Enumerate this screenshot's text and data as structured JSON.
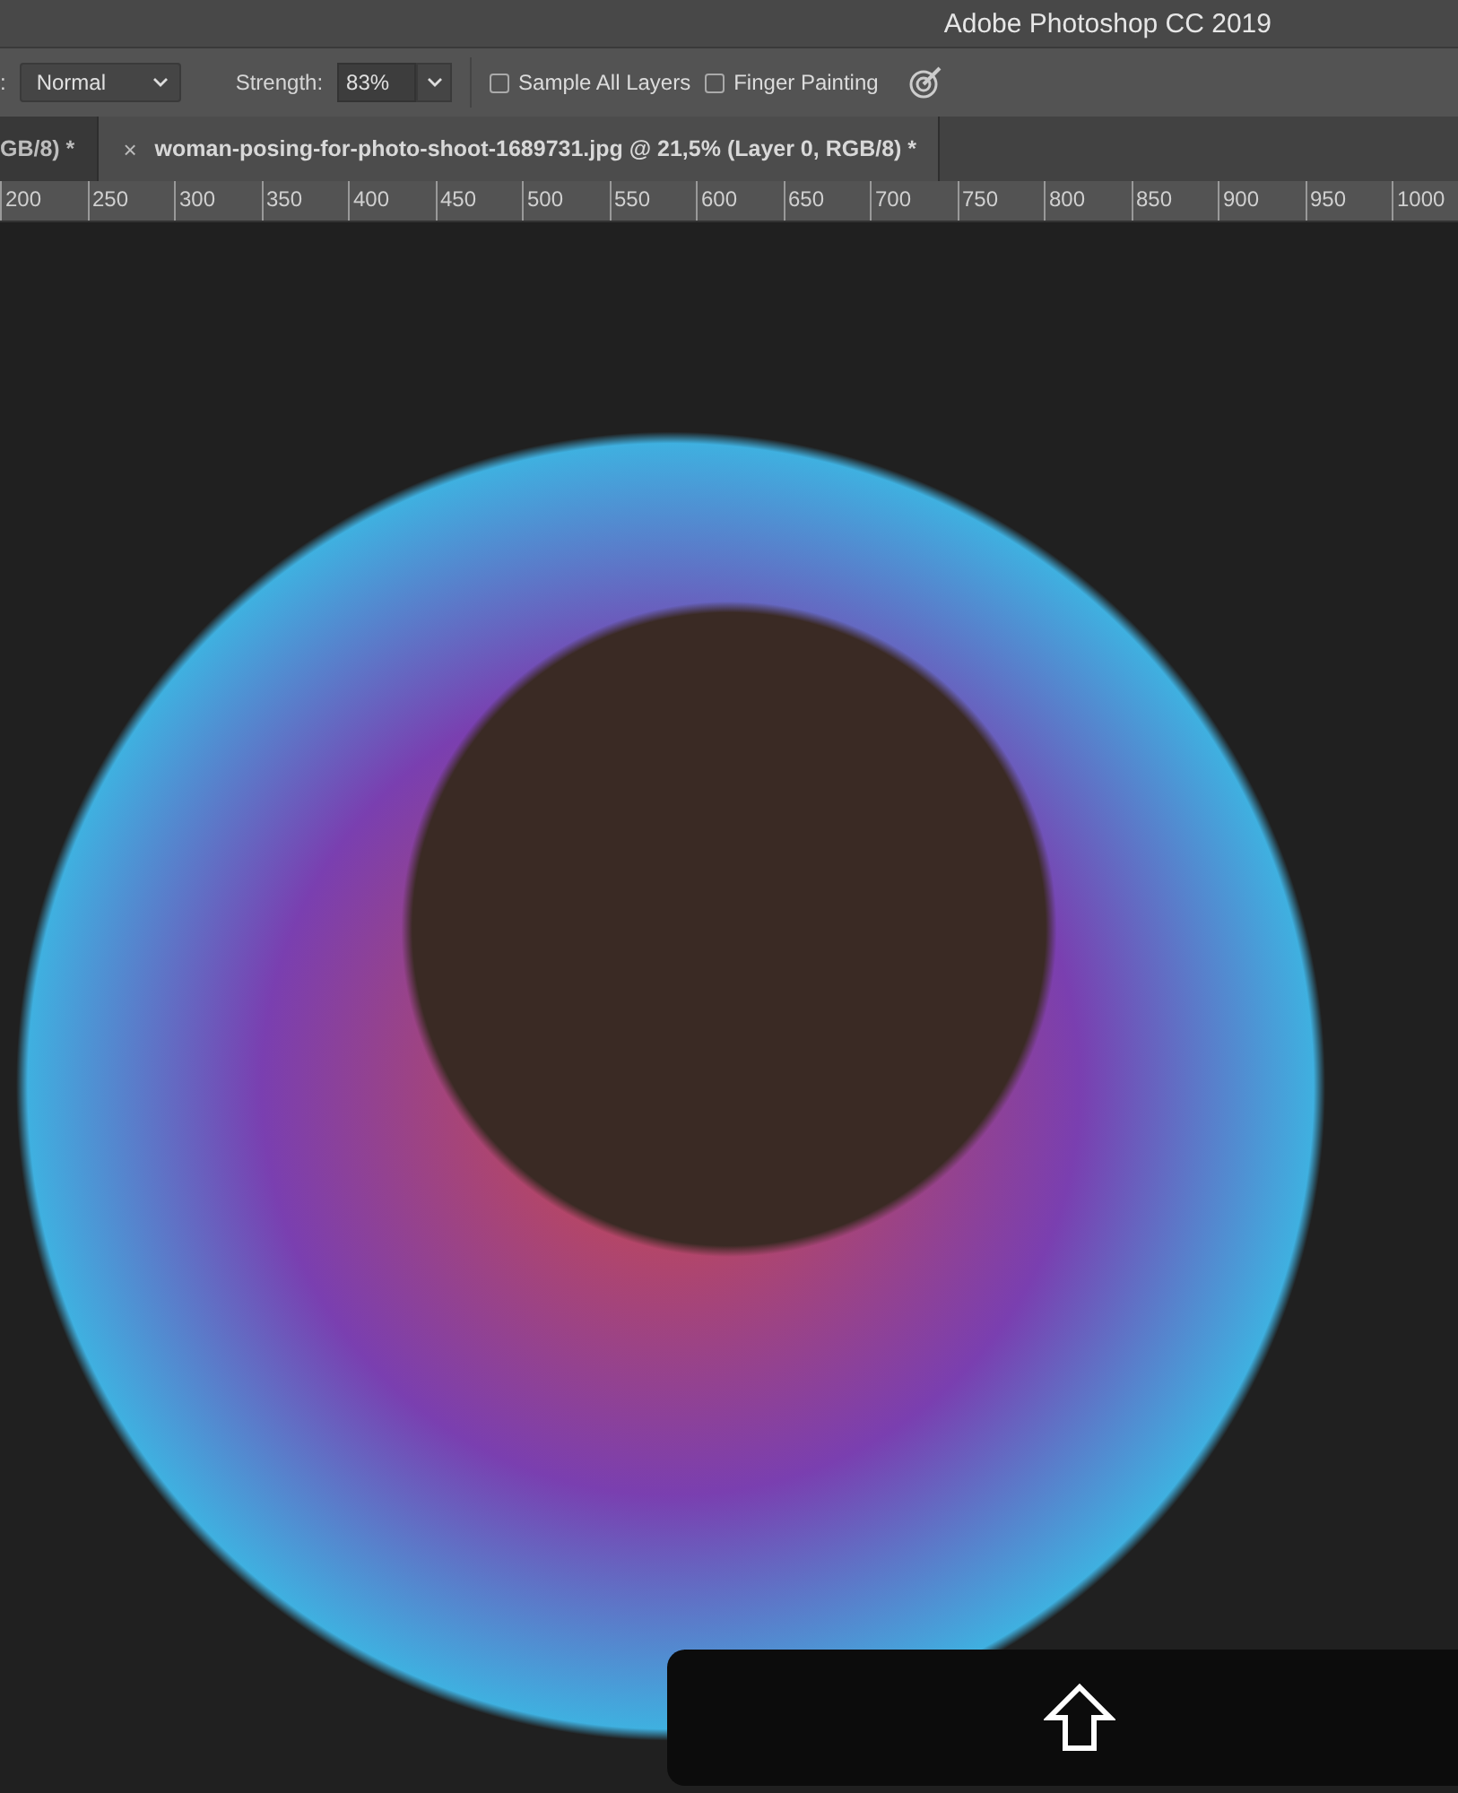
{
  "window": {
    "title": "Adobe Photoshop CC 2019"
  },
  "options_bar": {
    "mode_label": ":",
    "mode": "Normal",
    "strength_label": "Strength:",
    "strength": "83%",
    "checkboxes": [
      {
        "label": "Sample All Layers",
        "checked": false
      },
      {
        "label": "Finger Painting",
        "checked": false
      }
    ]
  },
  "tabs": [
    {
      "label": "GB/8) *",
      "selected": false
    },
    {
      "label": "woman-posing-for-photo-shoot-1689731.jpg @ 21,5% (Layer 0, RGB/8) *",
      "selected": true,
      "close": "×"
    }
  ],
  "ruler": [
    "200",
    "250",
    "300",
    "350",
    "400",
    "450",
    "500",
    "550",
    "600",
    "650",
    "700",
    "750",
    "800",
    "850",
    "900",
    "950",
    "1000"
  ]
}
